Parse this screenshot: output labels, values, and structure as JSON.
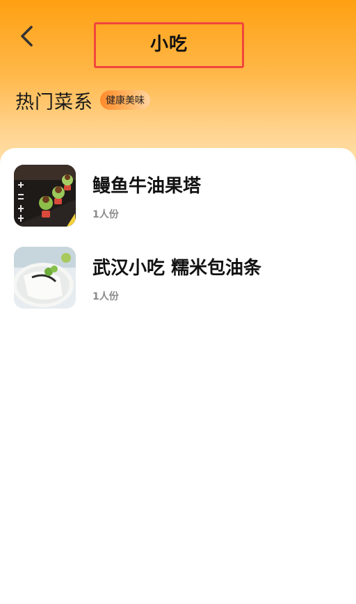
{
  "header": {
    "title": "小吃"
  },
  "section": {
    "title": "热门菜系",
    "tag": "健康美味"
  },
  "recipes": [
    {
      "name": "鳗鱼牛油果塔",
      "serving": "1人份"
    },
    {
      "name": "武汉小吃 糯米包油条",
      "serving": "1人份"
    }
  ],
  "colors": {
    "header_top": "#ffa012",
    "header_bottom": "#ffe0aa",
    "title_outline": "#f0463c",
    "tag_start": "#ff8a2a",
    "serving_text": "#8a8a8a"
  }
}
